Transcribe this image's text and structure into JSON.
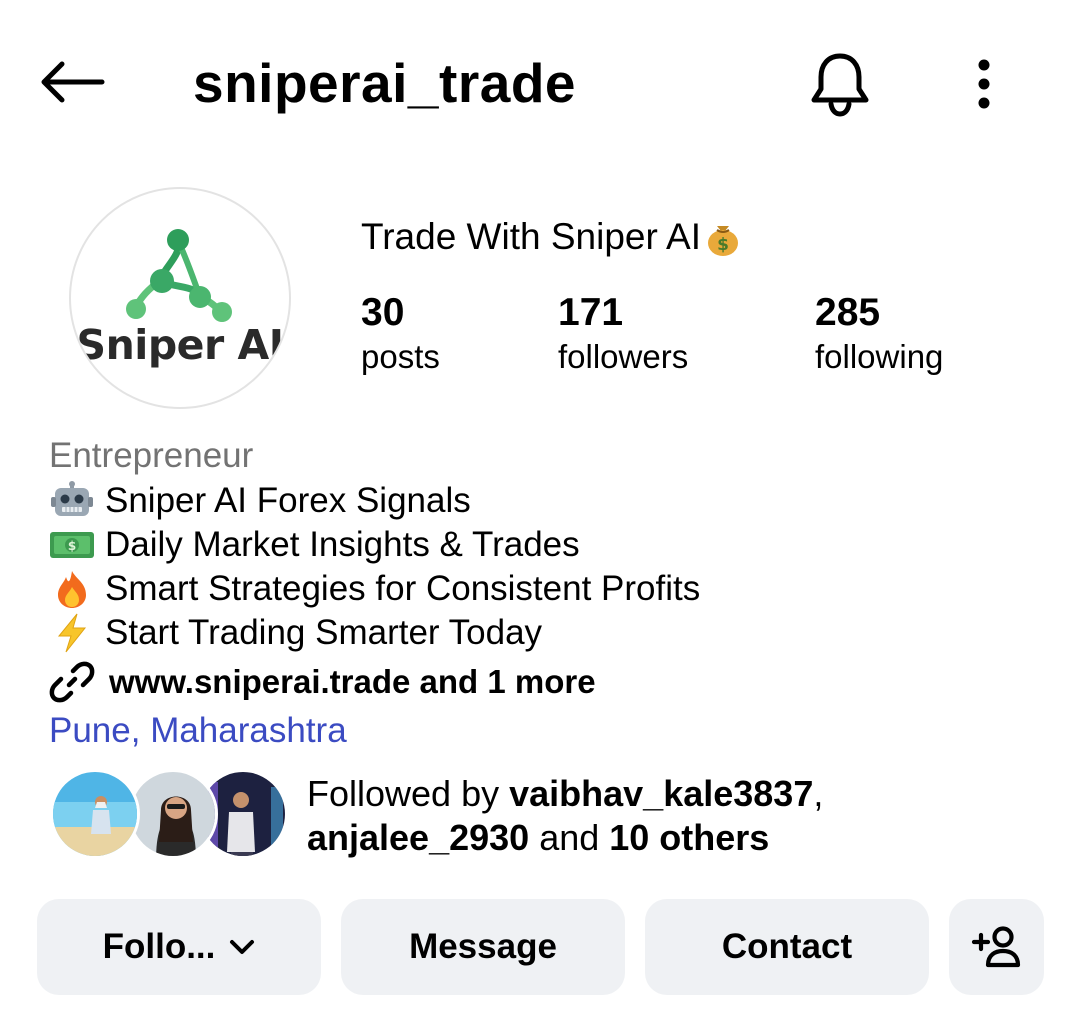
{
  "header": {
    "username": "sniperai_trade",
    "back_icon": "arrow-left-icon",
    "bell_icon": "bell-icon",
    "more_icon": "more-vertical-icon"
  },
  "profile": {
    "avatar_text": "Sniper AI",
    "display_name": "Trade With Sniper AI",
    "display_name_emoji": "money-bag-emoji",
    "stats": {
      "posts": {
        "value": "30",
        "label": "posts"
      },
      "followers": {
        "value": "171",
        "label": "followers"
      },
      "following": {
        "value": "285",
        "label": "following"
      }
    }
  },
  "bio": {
    "category": "Entrepreneur",
    "lines": [
      {
        "emoji": "robot-emoji",
        "text": "Sniper AI Forex Signals"
      },
      {
        "emoji": "dollar-banknote-emoji",
        "text": "Daily Market Insights & Trades"
      },
      {
        "emoji": "fire-emoji",
        "text": "Smart Strategies for Consistent Profits"
      },
      {
        "emoji": "lightning-emoji",
        "text": "Start Trading Smarter Today"
      }
    ],
    "link": "www.sniperai.trade and 1 more",
    "location": "Pune, Maharashtra"
  },
  "followed_by": {
    "prefix": "Followed by ",
    "user1": "vaibhav_kale3837",
    "separator": ",",
    "user2": "anjalee_2930",
    "middle": " and ",
    "others": "10 others"
  },
  "actions": {
    "follow_label": "Follo...",
    "message_label": "Message",
    "contact_label": "Contact",
    "add_user_icon": "add-person-icon"
  },
  "colors": {
    "location_link": "#3b4bc2",
    "category_text": "#737373",
    "button_bg": "#eff1f4",
    "logo_green_dark": "#2e9e5b",
    "logo_green_light": "#5fc37a"
  }
}
